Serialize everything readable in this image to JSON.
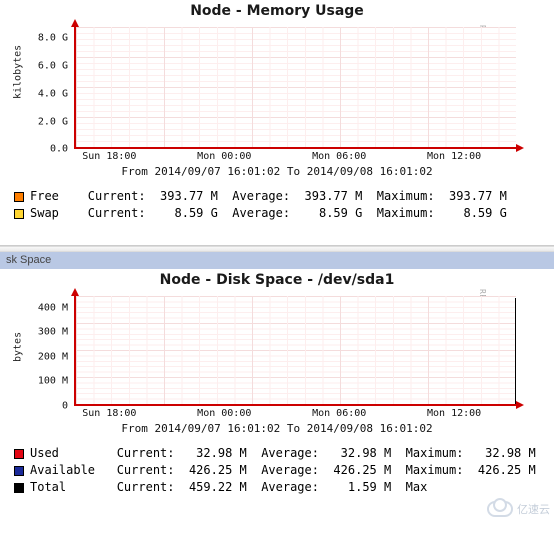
{
  "memory": {
    "title": "Node - Memory Usage",
    "ylabel": "kilobytes",
    "rlabel": "RRDTOOL / TOBI OETIKER",
    "timerange": "From 2014/09/07 16:01:02 To 2014/09/08 16:01:02",
    "yticks": [
      {
        "label": "8.0 G",
        "pos": 9
      },
      {
        "label": "6.0 G",
        "pos": 32
      },
      {
        "label": "4.0 G",
        "pos": 55
      },
      {
        "label": "2.0 G",
        "pos": 78
      },
      {
        "label": "0.0",
        "pos": 100
      }
    ],
    "xticks": [
      {
        "label": "Sun 18:00",
        "pos": 8
      },
      {
        "label": "Mon 00:00",
        "pos": 34
      },
      {
        "label": "Mon 06:00",
        "pos": 60
      },
      {
        "label": "Mon 12:00",
        "pos": 86
      }
    ],
    "legend": [
      {
        "name": "Free",
        "color": "#ff7f00",
        "cur": "393.77 M",
        "avg": "393.77 M",
        "max": "393.77 M"
      },
      {
        "name": "Swap",
        "color": "#ffd633",
        "cur": "8.59 G",
        "avg": "8.59 G",
        "max": "8.59 G"
      }
    ],
    "cols": {
      "name_w": 6,
      "cur": "Current:",
      "avg": "Average:",
      "max": "Maximum:"
    }
  },
  "section_bar": "sk Space",
  "disk": {
    "title": "Node - Disk Space - /dev/sda1",
    "ylabel": "bytes",
    "rlabel": "RRDTOOL / TOBI OETIKER",
    "timerange": "From 2014/09/07 16:01:02 To 2014/09/08 16:01:02",
    "yticks": [
      {
        "label": "400 M",
        "pos": 11
      },
      {
        "label": "300 M",
        "pos": 33
      },
      {
        "label": "200 M",
        "pos": 55
      },
      {
        "label": "100 M",
        "pos": 77
      },
      {
        "label": "0",
        "pos": 100
      }
    ],
    "xticks": [
      {
        "label": "Sun 18:00",
        "pos": 8
      },
      {
        "label": "Mon 00:00",
        "pos": 34
      },
      {
        "label": "Mon 06:00",
        "pos": 60
      },
      {
        "label": "Mon 12:00",
        "pos": 86
      }
    ],
    "legend": [
      {
        "name": "Used",
        "color": "#e30613",
        "cur": "32.98 M",
        "avg": "32.98 M",
        "max": "32.98 M"
      },
      {
        "name": "Available",
        "color": "#1a2a99",
        "cur": "426.25 M",
        "avg": "426.25 M",
        "max": "426.25 M"
      },
      {
        "name": "Total",
        "color": "#000000",
        "cur": "459.22 M",
        "avg": "1.59 M",
        "max": ""
      }
    ],
    "cols": {
      "name_w": 10,
      "cur": "Current:",
      "avg": "Average:",
      "max_short": "Max",
      "max": "Maximum:"
    }
  },
  "watermark": "亿速云",
  "chart_data": [
    {
      "type": "line",
      "title": "Node - Memory Usage",
      "xlabel": "",
      "ylabel": "kilobytes",
      "ylim": [
        0,
        9000000
      ],
      "x_ticks": [
        "Sun 18:00",
        "Mon 00:00",
        "Mon 06:00",
        "Mon 12:00"
      ],
      "series": [
        {
          "name": "Free",
          "color": "#ff7f00",
          "values": [
            393770,
            393770,
            393770,
            393770
          ],
          "stats": {
            "current": "393.77 M",
            "average": "393.77 M",
            "maximum": "393.77 M"
          }
        },
        {
          "name": "Swap",
          "color": "#ffd633",
          "values": [
            8590000,
            8590000,
            8590000,
            8590000
          ],
          "stats": {
            "current": "8.59 G",
            "average": "8.59 G",
            "maximum": "8.59 G"
          }
        }
      ],
      "time_range": {
        "from": "2014/09/07 16:01:02",
        "to": "2014/09/08 16:01:02"
      }
    },
    {
      "type": "line",
      "title": "Node - Disk Space - /dev/sda1",
      "xlabel": "",
      "ylabel": "bytes",
      "ylim": [
        0,
        460000000
      ],
      "x_ticks": [
        "Sun 18:00",
        "Mon 00:00",
        "Mon 06:00",
        "Mon 12:00"
      ],
      "series": [
        {
          "name": "Used",
          "color": "#e30613",
          "values": [
            32980000,
            32980000,
            32980000,
            32980000
          ],
          "stats": {
            "current": "32.98 M",
            "average": "32.98 M",
            "maximum": "32.98 M"
          }
        },
        {
          "name": "Available",
          "color": "#1a2a99",
          "values": [
            426250000,
            426250000,
            426250000,
            426250000
          ],
          "stats": {
            "current": "426.25 M",
            "average": "426.25 M",
            "maximum": "426.25 M"
          }
        },
        {
          "name": "Total",
          "color": "#000000",
          "values": [
            459220000,
            459220000,
            459220000,
            459220000
          ],
          "stats": {
            "current": "459.22 M",
            "average": "1.59 M",
            "maximum": ""
          }
        }
      ],
      "time_range": {
        "from": "2014/09/07 16:01:02",
        "to": "2014/09/08 16:01:02"
      }
    }
  ]
}
